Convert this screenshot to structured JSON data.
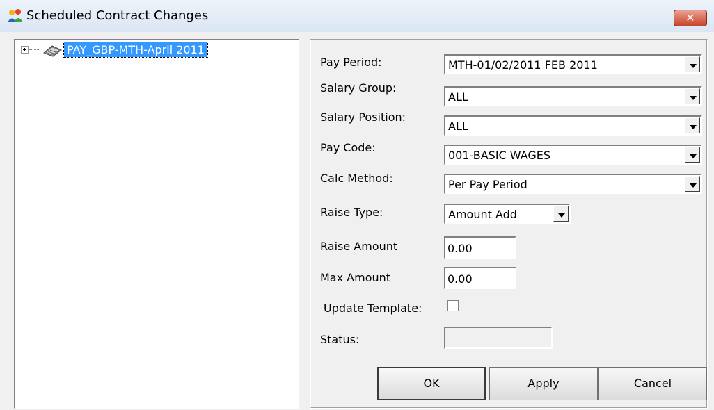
{
  "window": {
    "title": "Scheduled Contract Changes",
    "close_glyph": "✕",
    "icon": "people-group-icon"
  },
  "tree": {
    "node_label": "PAY_GBP-MTH-April 2011",
    "node_icon": "payroll-book-icon",
    "expanded": false,
    "selected": true
  },
  "form": {
    "pay_period": {
      "label": "Pay Period:",
      "value": "MTH-01/02/2011  FEB 2011"
    },
    "salary_group": {
      "label": "Salary Group:",
      "value": "ALL"
    },
    "salary_position": {
      "label": "Salary Position:",
      "value": "ALL"
    },
    "pay_code": {
      "label": "Pay Code:",
      "value": "001-BASIC WAGES"
    },
    "calc_method": {
      "label": "Calc Method:",
      "value": "Per Pay Period"
    },
    "raise_type": {
      "label": "Raise Type:",
      "value": "Amount Add"
    },
    "raise_amount": {
      "label": "Raise Amount",
      "value": "0.00"
    },
    "max_amount": {
      "label": "Max Amount",
      "value": "0.00"
    },
    "update_template": {
      "label": "Update Template:",
      "checked": false
    },
    "status": {
      "label": "Status:",
      "value": ""
    }
  },
  "buttons": {
    "ok": "OK",
    "apply": "Apply",
    "cancel": "Cancel"
  },
  "colors": {
    "selection": "#3399ff",
    "close_button": "#c8432b",
    "dialog_background": "#f0f0f0"
  }
}
